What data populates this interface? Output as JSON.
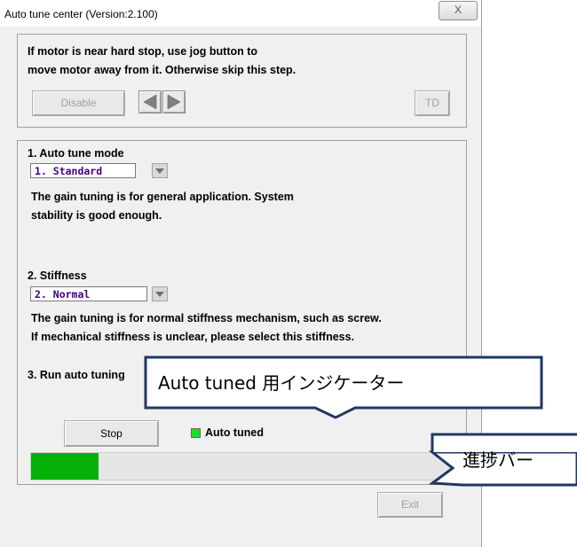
{
  "window": {
    "title": "Auto tune center (Version:2.100)",
    "close_label": "X"
  },
  "jog_section": {
    "instruction_line1": "If motor is near hard stop, use jog button to",
    "instruction_line2": "move motor away from it. Otherwise skip this step.",
    "disable_label": "Disable",
    "td_label": "TD"
  },
  "auto_tune_mode": {
    "heading": "1. Auto tune mode",
    "selected": "1. Standard",
    "description_line1": "The gain tuning is for general application. System",
    "description_line2": "stability is good enough."
  },
  "stiffness": {
    "heading": "2. Stiffness",
    "selected": "2. Normal",
    "description_line1": "The gain tuning is for normal stiffness mechanism, such as screw.",
    "description_line2": "If mechanical stiffness is unclear, please select this stiffness."
  },
  "run": {
    "heading": "3. Run auto tuning",
    "stop_label": "Stop",
    "indicator_label": "Auto tuned",
    "indicator_color": "#22dd22",
    "progress_fraction": 0.155,
    "progress_color": "#06b006"
  },
  "exit_label": "Exit",
  "callouts": {
    "indicator_note": "Auto tuned  用インジケーター",
    "progress_note": "進捗バー"
  }
}
